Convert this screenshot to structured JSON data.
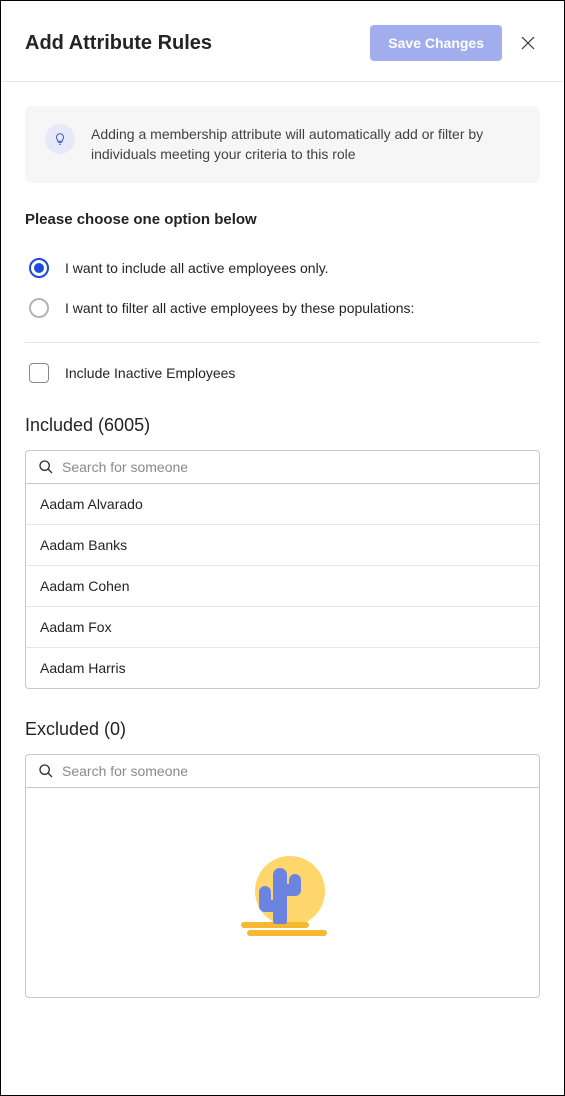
{
  "header": {
    "title": "Add Attribute Rules",
    "save_label": "Save Changes"
  },
  "banner": {
    "text": "Adding a membership attribute will automatically add or filter by individuals meeting your criteria to this role"
  },
  "prompt": "Please choose one option below",
  "options": {
    "include_all": "I want to include all active employees only.",
    "filter_by": "I want to filter all active employees by these populations:"
  },
  "checkbox": {
    "inactive_label": "Include Inactive Employees"
  },
  "included": {
    "title": "Included (6005)",
    "search_placeholder": "Search for someone",
    "items": [
      "Aadam Alvarado",
      "Aadam Banks",
      "Aadam Cohen",
      "Aadam Fox",
      "Aadam Harris"
    ]
  },
  "excluded": {
    "title": "Excluded (0)",
    "search_placeholder": "Search for someone"
  }
}
